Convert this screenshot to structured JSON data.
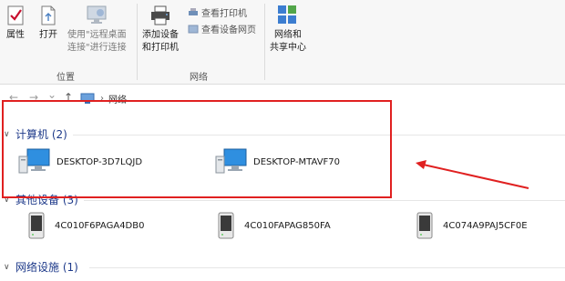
{
  "ribbon": {
    "properties_label": "属性",
    "open_label": "打开",
    "remote_desktop_label_line1": "使用\"远程桌面",
    "remote_desktop_label_line2": "连接\"进行连接",
    "add_device_label_line1": "添加设备",
    "add_device_label_line2": "和打印机",
    "view_printers_label": "查看打印机",
    "view_device_page_label": "查看设备网页",
    "network_center_label_line1": "网络和",
    "network_center_label_line2": "共享中心",
    "group_location": "位置",
    "group_network": "网络"
  },
  "address": {
    "back": "←",
    "forward": "→",
    "dropdown": "⌄",
    "up": "↑",
    "path": "网络"
  },
  "sections": {
    "computers": {
      "title": "计算机 (2)",
      "items": [
        "DESKTOP-3D7LQJD",
        "DESKTOP-MTAVF70"
      ]
    },
    "other_devices": {
      "title": "其他设备 (3)",
      "items": [
        "4C010F6PAGA4DB0",
        "4C010FAPAG850FA",
        "4C074A9PAJ5CF0E"
      ]
    },
    "network_infra": {
      "title": "网络设施 (1)"
    }
  },
  "colors": {
    "annotation": "#e02020",
    "section_header": "#1e3a8a"
  }
}
